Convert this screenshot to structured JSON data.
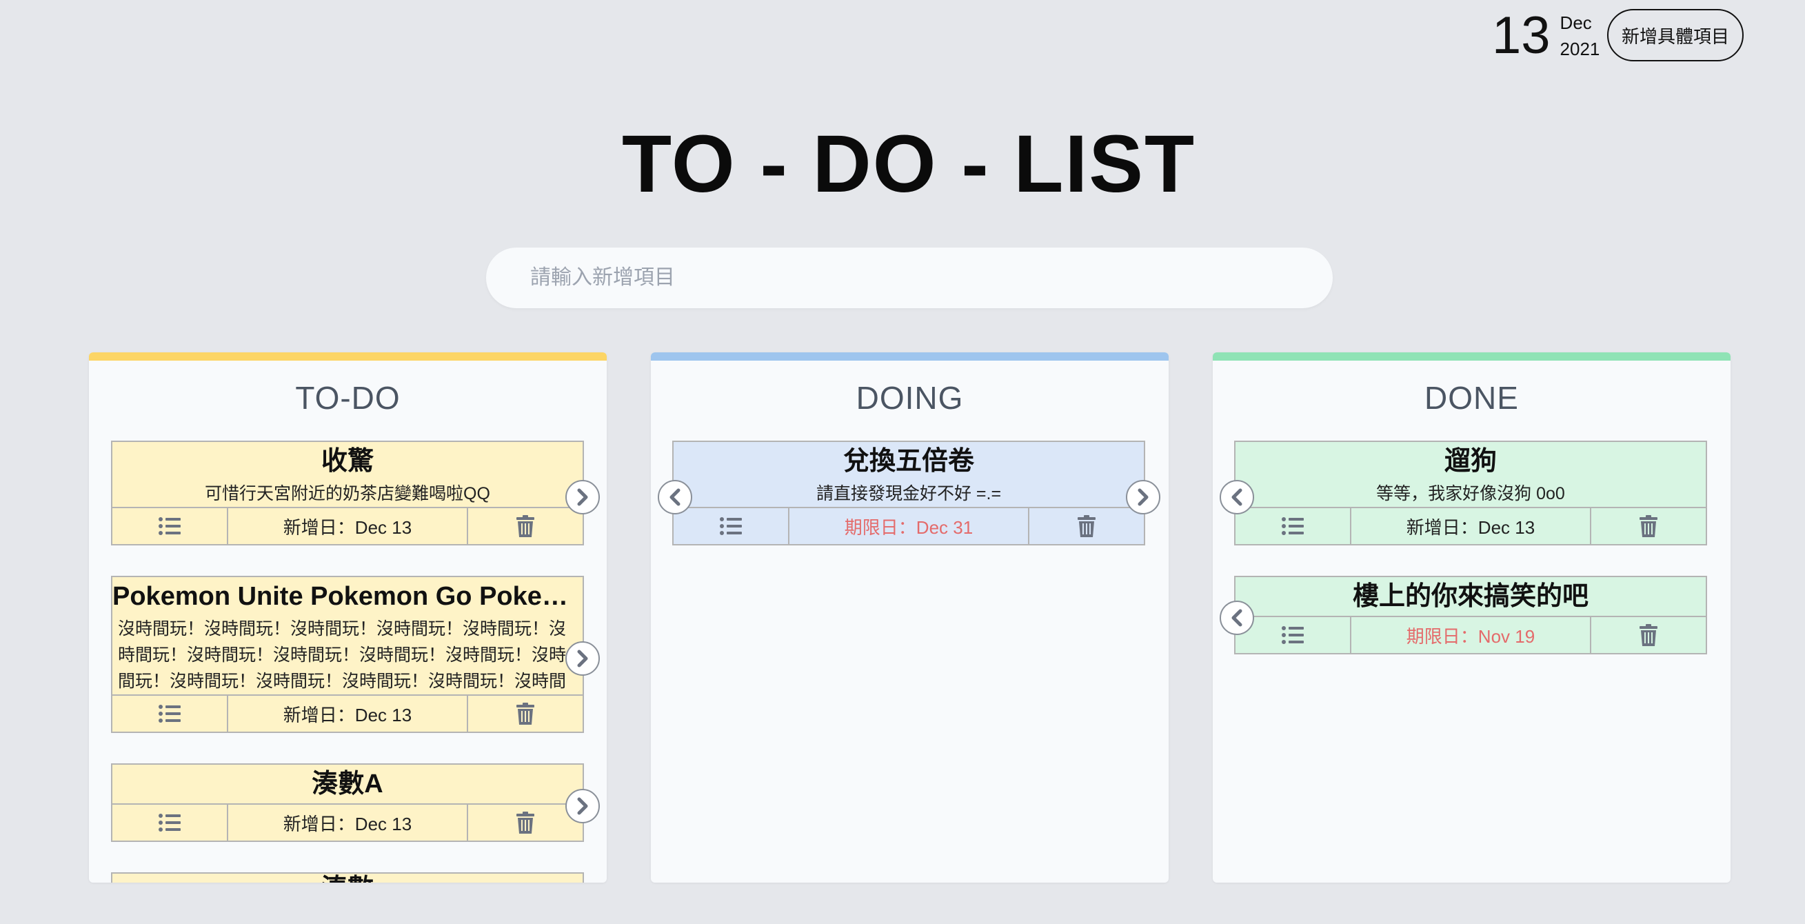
{
  "header": {
    "day": "13",
    "month": "Dec",
    "year": "2021",
    "add_button": "新增具體項目"
  },
  "title": "TO - DO - LIST",
  "search": {
    "placeholder": "請輸入新增項目"
  },
  "columns": [
    {
      "name": "TO-DO",
      "accent": "#fcd565",
      "cards": [
        {
          "title": "收驚",
          "desc": "可惜行天宮附近的奶茶店變難喝啦QQ",
          "date": "新增日：Dec 13"
        },
        {
          "title": "Pokemon Unite Pokemon Go Pokem...",
          "desc": "沒時間玩！沒時間玩！沒時間玩！沒時間玩！沒時間玩！沒時間玩！沒時間玩！沒時間玩！沒時間玩！沒時間玩！沒時間玩！沒時間玩！沒時間玩！沒時間玩！沒時間玩！沒時間玩！沒...",
          "date": "新增日：Dec 13"
        },
        {
          "title": "湊數A",
          "desc": "",
          "date": "新增日：Dec 13"
        },
        {
          "title": "湊數",
          "desc": "",
          "date": ""
        }
      ]
    },
    {
      "name": "DOING",
      "accent": "#9ec5ee",
      "cards": [
        {
          "title": "兌換五倍卷",
          "desc": "請直接發現金好不好 =.=",
          "date": "期限日：Dec 31"
        }
      ]
    },
    {
      "name": "DONE",
      "accent": "#8fe3b5",
      "cards": [
        {
          "title": "遛狗",
          "desc": "等等，我家好像沒狗 0o0",
          "date": "新增日：Dec 13"
        },
        {
          "title": "樓上的你來搞笑的吧",
          "desc": "",
          "date": "期限日：Nov 19"
        }
      ]
    }
  ],
  "icons": {
    "list": "list-icon",
    "trash": "trash-icon",
    "next": "chevron-right-icon",
    "prev": "chevron-left-icon"
  },
  "colors": {
    "todo_card": "#fef3c7",
    "doing_card": "#dbe7f8",
    "done_card": "#d8f5e3",
    "due_text": "#e46b6b"
  }
}
